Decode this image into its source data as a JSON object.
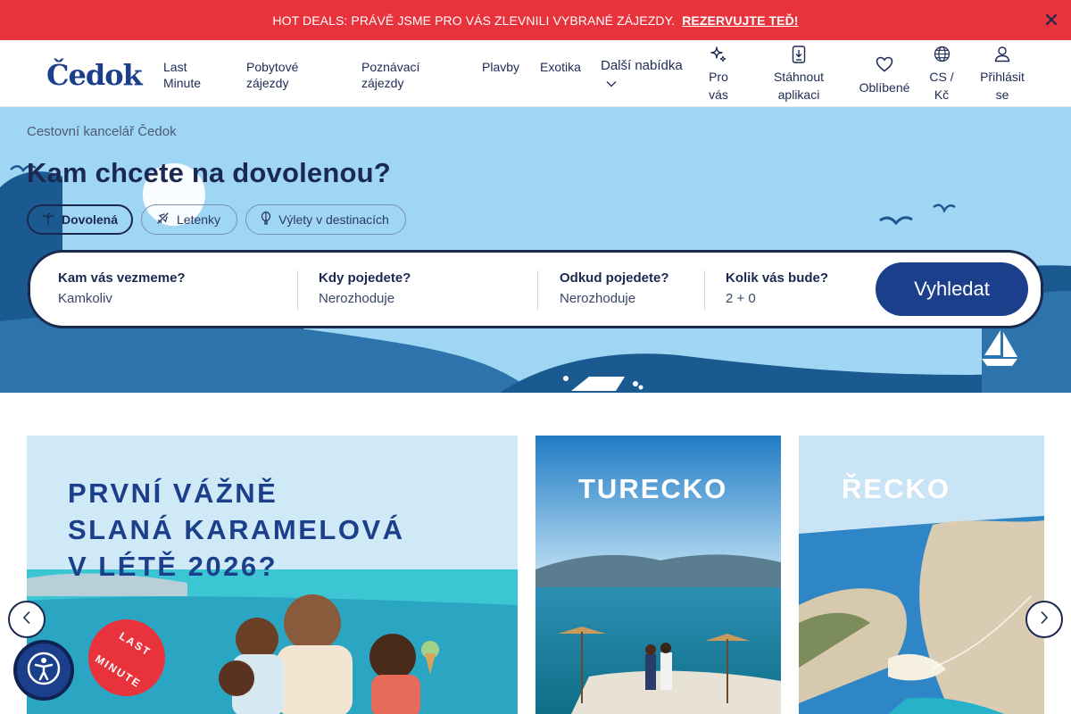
{
  "promo_bar": {
    "message": "HOT DEALS: PRÁVĚ JSME PRO VÁS ZLEVNILI VYBRANÉ ZÁJEZDY.",
    "cta": "REZERVUJTE TEĎ!",
    "close_icon": "close-icon"
  },
  "header": {
    "logo_text": "Čedok",
    "nav": [
      {
        "line1": "Last",
        "line2": "Minute"
      },
      {
        "line1": "Pobytové",
        "line2": "zájezdy"
      },
      {
        "line1": "Poznávací",
        "line2": "zájezdy"
      },
      {
        "line1": "Plavby",
        "line2": ""
      },
      {
        "line1": "Exotika",
        "line2": ""
      },
      {
        "line1": "Další nabídka",
        "line2": ""
      }
    ],
    "utilities": [
      {
        "icon": "sparkle-icon",
        "line1": "Pro",
        "line2": "vás"
      },
      {
        "icon": "download-app-icon",
        "line1": "Stáhnout",
        "line2": "aplikaci"
      },
      {
        "icon": "heart-icon",
        "line1": "Oblíbené",
        "line2": ""
      },
      {
        "icon": "globe-icon",
        "line1": "CS /",
        "line2": "Kč"
      },
      {
        "icon": "user-icon",
        "line1": "Přihlásit",
        "line2": "se"
      }
    ]
  },
  "hero": {
    "breadcrumb": "Cestovní kancelář Čedok",
    "title": "Kam chcete na dovolenou?",
    "tabs": [
      {
        "label": "Dovolená",
        "icon": "palm-tree-icon",
        "active": true
      },
      {
        "label": "Letenky",
        "icon": "plane-icon",
        "active": false
      },
      {
        "label": "Výlety v destinacích",
        "icon": "balloon-icon",
        "active": false
      }
    ],
    "search": {
      "destination": {
        "label": "Kam vás vezmeme?",
        "value": "Kamkoliv"
      },
      "date": {
        "label": "Kdy pojedete?",
        "value": "Nerozhoduje"
      },
      "departure": {
        "label": "Odkud pojedete?",
        "value": "Nerozhoduje"
      },
      "travelers": {
        "label": "Kolik vás bude?",
        "value": "2 + 0"
      },
      "button": "Vyhledat"
    }
  },
  "cards": {
    "promo": {
      "line1": "PRVNÍ VÁŽNĚ",
      "line2": "SLANÁ KARAMELOVÁ",
      "line3": "V LÉTĚ 2026?",
      "badge_line1": "LAST",
      "badge_line2": "MINUTE"
    },
    "destinations": [
      {
        "title": "TURECKO"
      },
      {
        "title": "ŘECKO"
      }
    ]
  },
  "colors": {
    "promo_red": "#e8333d",
    "brand_blue": "#1b3f8b",
    "navy": "#1b2850",
    "hero_sky": "#9fd6f3"
  }
}
